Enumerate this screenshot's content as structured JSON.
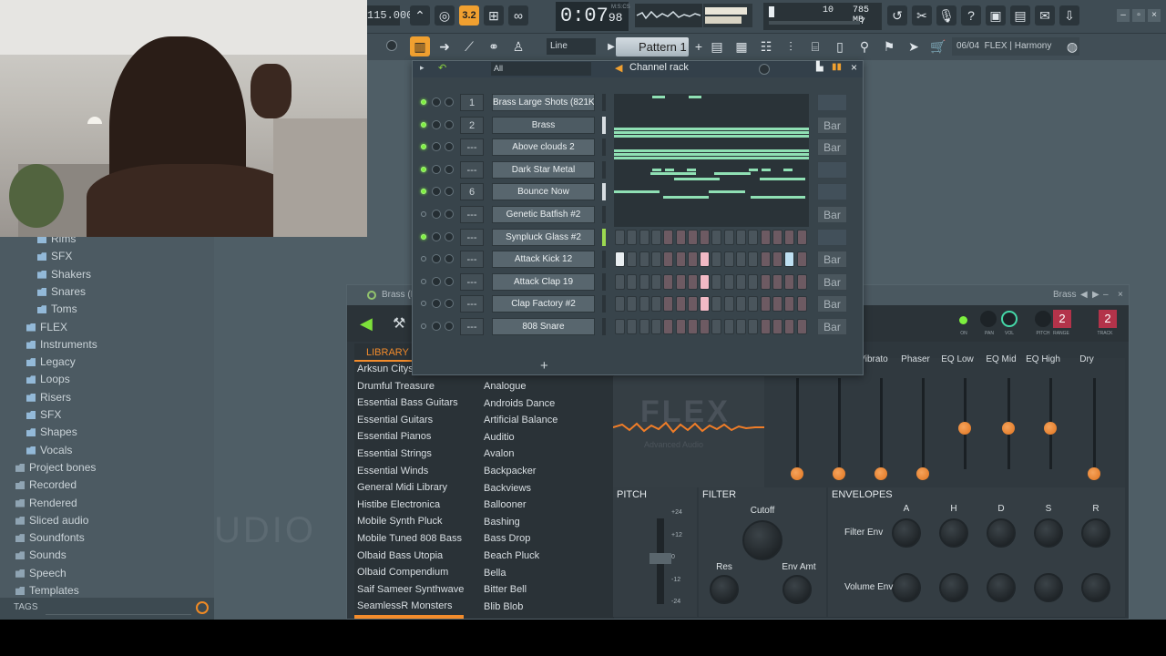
{
  "toolbar": {
    "tempo": "115.000",
    "pattern_step": "3.2",
    "song_time": "0:07",
    "song_time_sub": "98",
    "time_unit": "M:S:CS",
    "cpu_value": "10",
    "memory": "785 MB",
    "polyphony": "7",
    "snap_mode": "Line",
    "pattern_name": "Pattern 1",
    "hint_counter": "06/04",
    "hint_text": "FLEX | Harmony"
  },
  "browser": {
    "items": [
      {
        "label": "Rims",
        "indent": 2
      },
      {
        "label": "SFX",
        "indent": 2
      },
      {
        "label": "Shakers",
        "indent": 2
      },
      {
        "label": "Snares",
        "indent": 2
      },
      {
        "label": "Toms",
        "indent": 2
      },
      {
        "label": "FLEX",
        "indent": 1
      },
      {
        "label": "Instruments",
        "indent": 1
      },
      {
        "label": "Legacy",
        "indent": 1
      },
      {
        "label": "Loops",
        "indent": 1
      },
      {
        "label": "Risers",
        "indent": 1
      },
      {
        "label": "SFX",
        "indent": 1
      },
      {
        "label": "Shapes",
        "indent": 1
      },
      {
        "label": "Vocals",
        "indent": 1
      },
      {
        "label": "Project bones",
        "indent": 0
      },
      {
        "label": "Recorded",
        "indent": 0
      },
      {
        "label": "Rendered",
        "indent": 0
      },
      {
        "label": "Sliced audio",
        "indent": 0
      },
      {
        "label": "Soundfonts",
        "indent": 0
      },
      {
        "label": "Sounds",
        "indent": 0
      },
      {
        "label": "Speech",
        "indent": 0
      },
      {
        "label": "Templates",
        "indent": 0
      }
    ],
    "tags_label": "TAGS",
    "background_text": "UDIO"
  },
  "rack": {
    "filter": "All",
    "title": "Channel rack",
    "channels": [
      {
        "name": "Brass Large Shots (821KB)",
        "num": "1",
        "led": true,
        "bar": "",
        "type": "roll"
      },
      {
        "name": "Brass",
        "num": "2",
        "led": true,
        "bar": "Bar",
        "type": "roll"
      },
      {
        "name": "Above clouds 2",
        "num": "---",
        "led": true,
        "bar": "Bar",
        "type": "roll"
      },
      {
        "name": "Dark Star Metal",
        "num": "---",
        "led": true,
        "bar": "",
        "type": "roll"
      },
      {
        "name": "Bounce Now",
        "num": "6",
        "led": true,
        "bar": "",
        "type": "roll"
      },
      {
        "name": "Genetic Batfish #2",
        "num": "---",
        "led": false,
        "bar": "Bar",
        "type": "roll"
      },
      {
        "name": "Synpluck Glass #2",
        "num": "---",
        "led": true,
        "bar": "",
        "type": "steps"
      },
      {
        "name": "Attack Kick 12",
        "num": "---",
        "led": false,
        "bar": "Bar",
        "type": "steps"
      },
      {
        "name": "Attack Clap 19",
        "num": "---",
        "led": false,
        "bar": "Bar",
        "type": "steps"
      },
      {
        "name": "Clap Factory #2",
        "num": "---",
        "led": false,
        "bar": "Bar",
        "type": "steps"
      },
      {
        "name": "808 Snare",
        "num": "---",
        "led": false,
        "bar": "Bar",
        "type": "steps"
      }
    ],
    "add_label": "+"
  },
  "plugin": {
    "title": "Brass (I",
    "title_right": "Brass",
    "pitch_range": "2",
    "track": "2",
    "mini_labels": [
      "ON",
      "PAN",
      "VOL",
      "PITCH",
      "RANGE",
      "TRACK"
    ],
    "library_tab": "LIBRARY",
    "library_left": [
      "Arksun Cityscapes",
      "Drumful Treasure",
      "Essential Bass Guitars",
      "Essential Guitars",
      "Essential Pianos",
      "Essential Strings",
      "Essential Winds",
      "General Midi Library",
      "Histibe Electronica",
      "Mobile Synth Pluck",
      "Mobile Tuned 808 Bass",
      "Olbaid Bass Utopia",
      "Olbaid Compendium",
      "Saif Sameer Synthwave",
      "SeamlessR Monsters"
    ],
    "library_right": [
      "Analogue",
      "Androids Dance",
      "Artificial Balance",
      "Auditio",
      "Avalon",
      "Backpacker",
      "Backviews",
      "Ballooner",
      "Bashing",
      "Bass Drop",
      "Beach Pluck",
      "Bella",
      "Bitter Bell",
      "Blib Blob"
    ],
    "logo_text": "FLEX",
    "logo_sub": "Advanced Audio",
    "mixer_labels": [
      "Vibrato",
      "Phaser",
      "EQ Low",
      "EQ Mid",
      "EQ High",
      "Dry"
    ],
    "pitch_title": "PITCH",
    "pitch_scale": [
      "+24",
      "+12",
      "0",
      "-12",
      "-24"
    ],
    "filter_title": "FILTER",
    "filter_knobs": [
      "Cutoff",
      "Res",
      "Env Amt"
    ],
    "env_title": "ENVELOPES",
    "env_cols": [
      "A",
      "H",
      "D",
      "S",
      "R"
    ],
    "env_rows": [
      "Filter Env",
      "Volume Env"
    ]
  }
}
